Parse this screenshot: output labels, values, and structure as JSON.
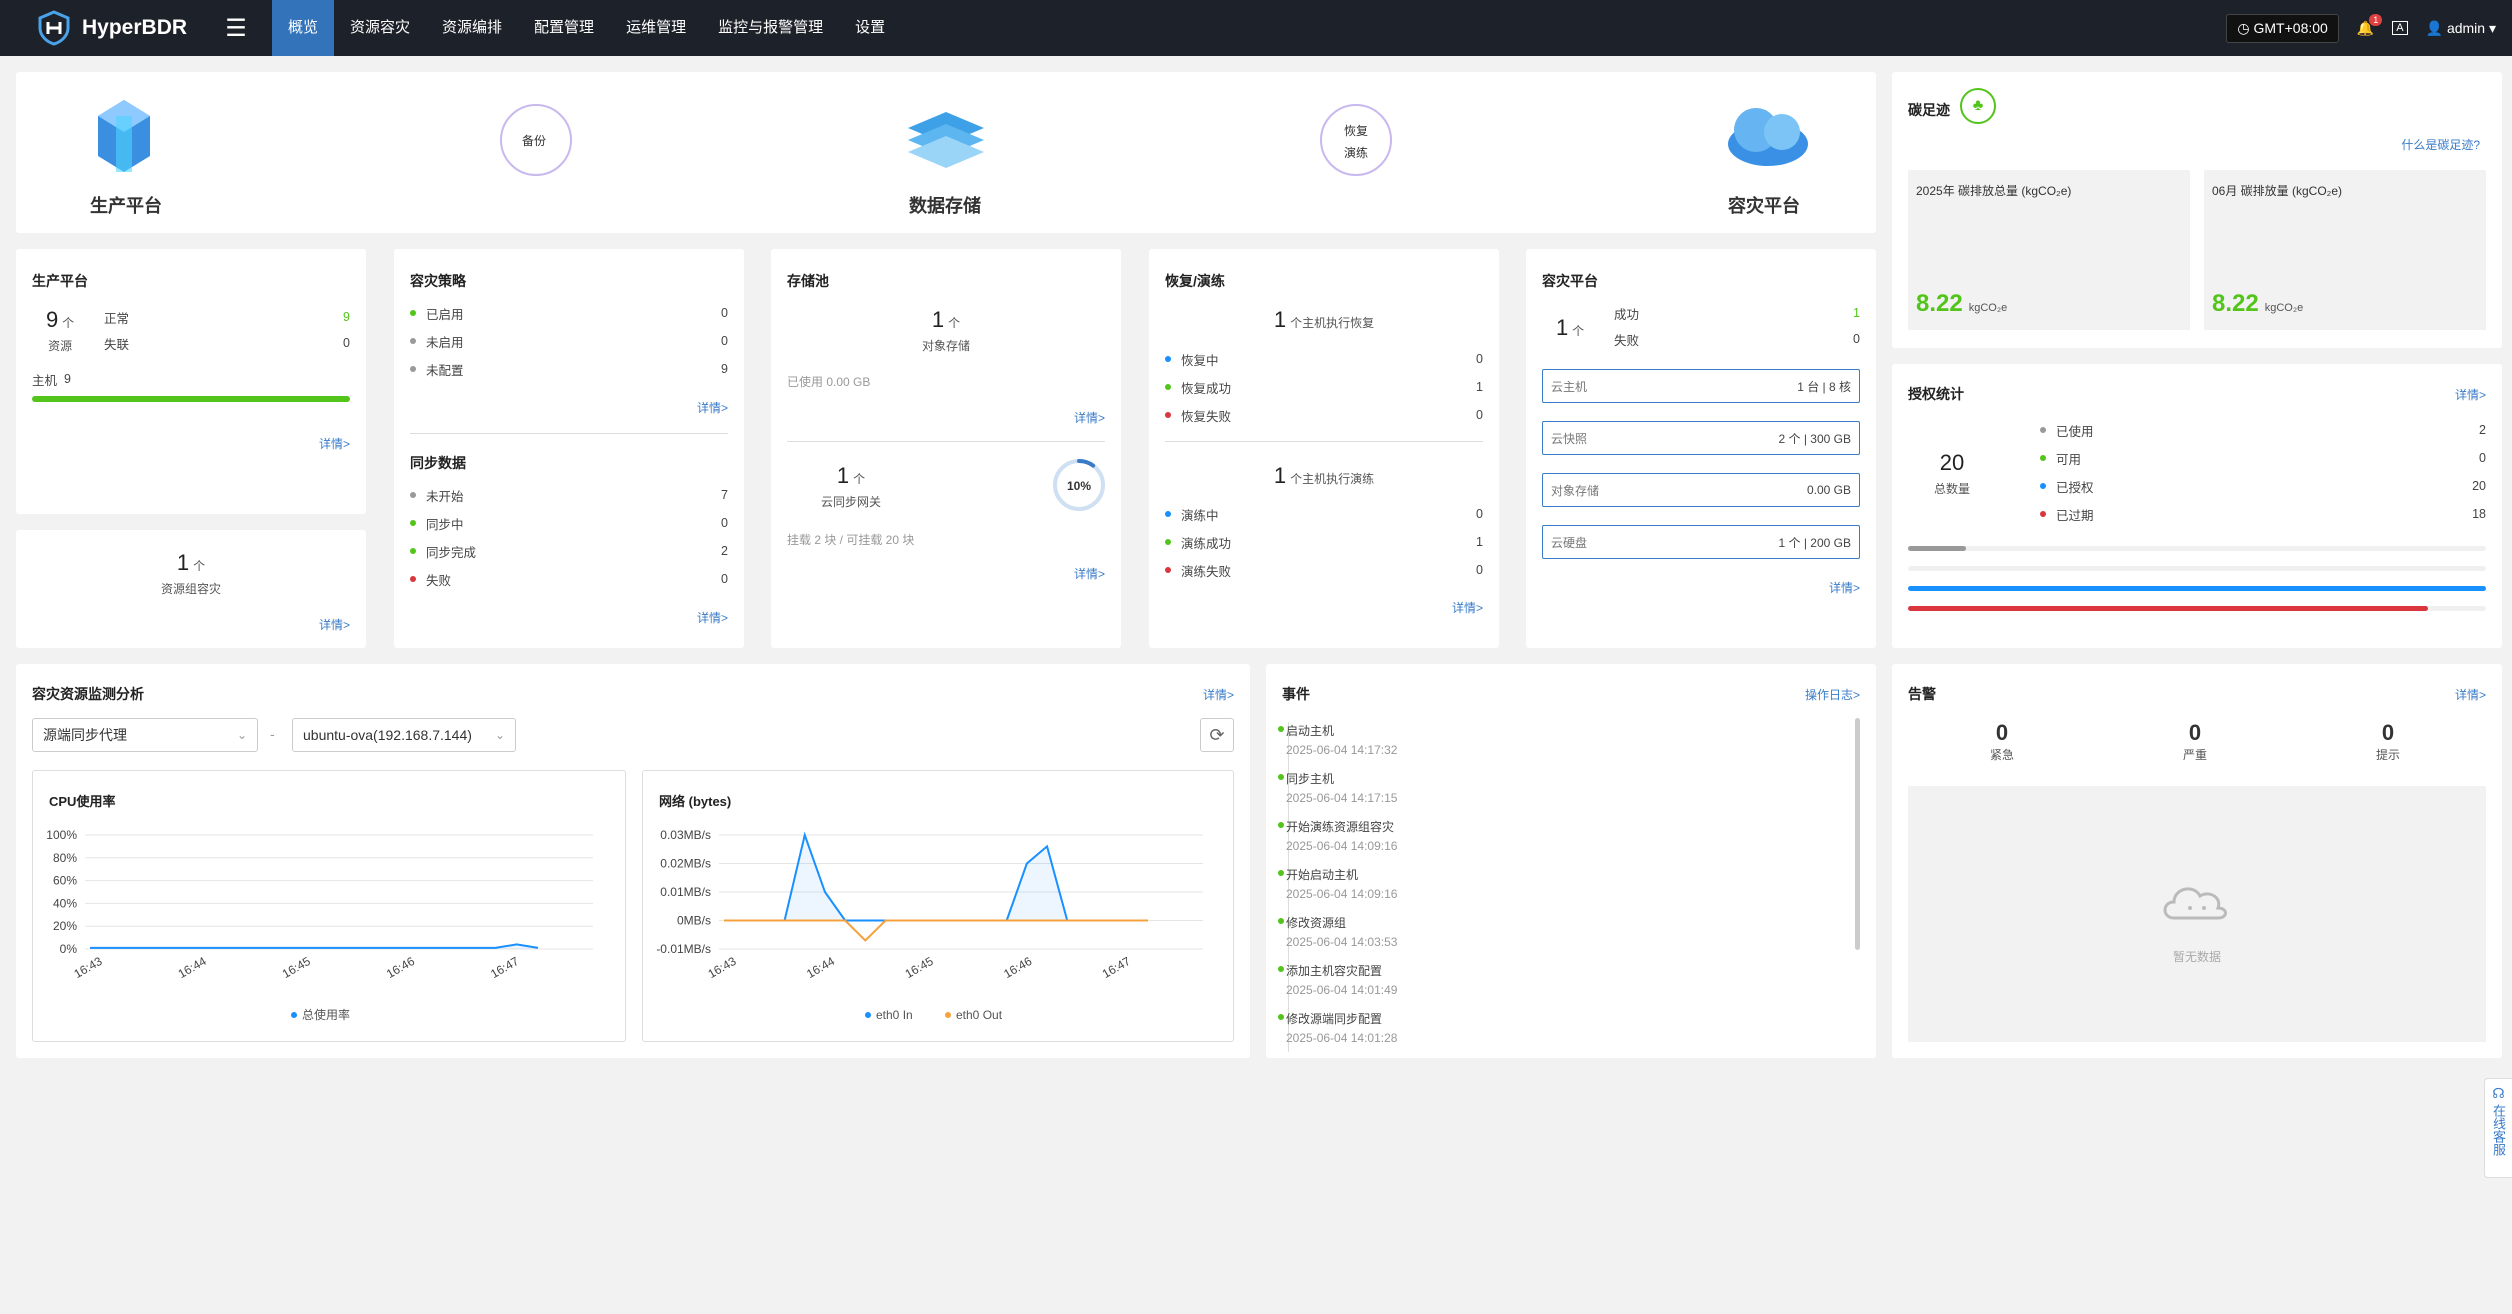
{
  "topbar": {
    "brand": "HyperBDR",
    "nav": [
      "概览",
      "资源容灾",
      "资源编排",
      "配置管理",
      "运维管理",
      "监控与报警管理",
      "设置"
    ],
    "timezone": "GMT+08:00",
    "user": "admin",
    "bell_count": "1"
  },
  "flow": {
    "production": "生产平台",
    "backup": "备份",
    "storage": "数据存储",
    "recover_a": "恢复",
    "recover_b": "演练",
    "dr": "容灾平台"
  },
  "prod": {
    "title": "生产平台",
    "count": "9",
    "unit": "个",
    "label": "资源",
    "normal": "正常",
    "normal_v": "9",
    "fail": "失联",
    "fail_v": "0",
    "host": "主机",
    "host_v": "9",
    "detail": "详情>"
  },
  "group": {
    "count": "1",
    "unit": "个",
    "label": "资源组容灾",
    "detail": "详情>"
  },
  "policy": {
    "title": "容灾策略",
    "items": [
      {
        "label": "已启用",
        "value": "0"
      },
      {
        "label": "未启用",
        "value": "0"
      },
      {
        "label": "未配置",
        "value": "9"
      }
    ],
    "detail": "详情>",
    "sync_title": "同步数据",
    "sync_items": [
      {
        "label": "未开始",
        "value": "7"
      },
      {
        "label": "同步中",
        "value": "0"
      },
      {
        "label": "同步完成",
        "value": "2"
      },
      {
        "label": "失败",
        "value": "0"
      }
    ],
    "sync_detail": "详情>"
  },
  "storage": {
    "title": "存储池",
    "count": "1",
    "unit": "个",
    "label": "对象存储",
    "used": "已使用 0.00 GB",
    "detail": "详情>",
    "gw_count": "1",
    "gw_unit": "个",
    "gw_label": "云同步网关",
    "mount": "挂载 2 块 / 可挂载 20 块",
    "pct": "10%",
    "pct_value": 10,
    "gw_detail": "详情>"
  },
  "recover": {
    "title": "恢复/演练",
    "rec_count": "1",
    "rec_label": "个主机执行恢复",
    "rec_items": [
      {
        "label": "恢复中",
        "value": "0"
      },
      {
        "label": "恢复成功",
        "value": "1"
      },
      {
        "label": "恢复失败",
        "value": "0"
      }
    ],
    "drill_count": "1",
    "drill_label": "个主机执行演练",
    "drill_items": [
      {
        "label": "演练中",
        "value": "0"
      },
      {
        "label": "演练成功",
        "value": "1"
      },
      {
        "label": "演练失败",
        "value": "0"
      }
    ],
    "detail": "详情>"
  },
  "drp": {
    "title": "容灾平台",
    "count": "1",
    "unit": "个",
    "ok": "成功",
    "ok_v": "1",
    "fail": "失败",
    "fail_v": "0",
    "boxes": [
      {
        "label": "云主机",
        "value": "1 台 | 8 核"
      },
      {
        "label": "云快照",
        "value": "2 个 | 300 GB"
      },
      {
        "label": "对象存储",
        "value": "0.00 GB"
      },
      {
        "label": "云硬盘",
        "value": "1 个 | 200 GB"
      }
    ],
    "detail": "详情>"
  },
  "carbon": {
    "title": "碳足迹",
    "link": "什么是碳足迹?",
    "y_label": "2025年 碳排放总量 (kgCO₂e)",
    "y_value": "8.22",
    "m_label": "06月 碳排放量 (kgCO₂e)",
    "m_value": "8.22",
    "unit": "kgCO₂e"
  },
  "license": {
    "title": "授权统计",
    "detail": "详情>",
    "total": "20",
    "total_label": "总数量",
    "items": [
      {
        "label": "已使用",
        "value": "2",
        "color": "#999999"
      },
      {
        "label": "可用",
        "value": "0",
        "color": "#52c41a"
      },
      {
        "label": "已授权",
        "value": "20",
        "color": "#1890ff"
      },
      {
        "label": "已过期",
        "value": "18",
        "color": "#d9363e"
      }
    ],
    "bars": [
      0.1,
      0,
      1,
      0.9
    ]
  },
  "monitor": {
    "title": "容灾资源监测分析",
    "detail": "详情>",
    "sel1": "源端同步代理",
    "sel2": "ubuntu-ova(192.168.7.144)",
    "sep": "-"
  },
  "chart_data": [
    {
      "type": "line",
      "title": "CPU使用率",
      "x": [
        "16:43",
        "16:44",
        "16:45",
        "16:46",
        "16:47"
      ],
      "ylim": [
        0,
        100
      ],
      "yticks": [
        "100%",
        "80%",
        "60%",
        "40%",
        "20%",
        "0%"
      ],
      "series": [
        {
          "name": "总使用率",
          "color": "#1890ff",
          "values": [
            1,
            1,
            1,
            1,
            1,
            1,
            1,
            1,
            1,
            1,
            1,
            1,
            1,
            1,
            1,
            1,
            1,
            1,
            1,
            1,
            4,
            1
          ]
        }
      ]
    },
    {
      "type": "line",
      "title": "网络 (bytes)",
      "x": [
        "16:43",
        "16:44",
        "16:45",
        "16:46",
        "16:47"
      ],
      "ylim": [
        -0.01,
        0.03
      ],
      "yticks": [
        "0.03MB/s",
        "0.02MB/s",
        "0.01MB/s",
        "0MB/s",
        "-0.01MB/s"
      ],
      "series": [
        {
          "name": "eth0 In",
          "color": "#1890ff",
          "values": [
            0,
            0,
            0,
            0,
            0.03,
            0.01,
            0,
            0,
            0,
            0,
            0,
            0,
            0,
            0,
            0,
            0.02,
            0.026,
            0,
            0,
            0,
            0,
            0
          ]
        },
        {
          "name": "eth0 Out",
          "color": "#f5a13c",
          "values": [
            0,
            0,
            0,
            0,
            0,
            0,
            0,
            -0.007,
            0,
            0,
            0,
            0,
            0,
            0,
            0,
            0,
            0,
            0,
            0,
            0,
            0,
            0
          ]
        }
      ]
    }
  ],
  "events": {
    "title": "事件",
    "link": "操作日志>",
    "items": [
      {
        "t": "启动主机",
        "d": "2025-06-04 14:17:32"
      },
      {
        "t": "同步主机",
        "d": "2025-06-04 14:17:15"
      },
      {
        "t": "开始演练资源组容灾",
        "d": "2025-06-04 14:09:16"
      },
      {
        "t": "开始启动主机",
        "d": "2025-06-04 14:09:16"
      },
      {
        "t": "修改资源组",
        "d": "2025-06-04 14:03:53"
      },
      {
        "t": "添加主机容灾配置",
        "d": "2025-06-04 14:01:49"
      },
      {
        "t": "修改源端同步配置",
        "d": "2025-06-04 14:01:28"
      }
    ]
  },
  "alarm": {
    "title": "告警",
    "detail": "详情>",
    "items": [
      {
        "value": "0",
        "label": "紧急"
      },
      {
        "value": "0",
        "label": "严重"
      },
      {
        "value": "0",
        "label": "提示"
      }
    ],
    "empty": "暂无数据"
  },
  "support": "在线客服",
  "colors": {
    "accent": "#3273ba",
    "green": "#52c41a",
    "red": "#d9363e",
    "blue": "#1890ff"
  }
}
